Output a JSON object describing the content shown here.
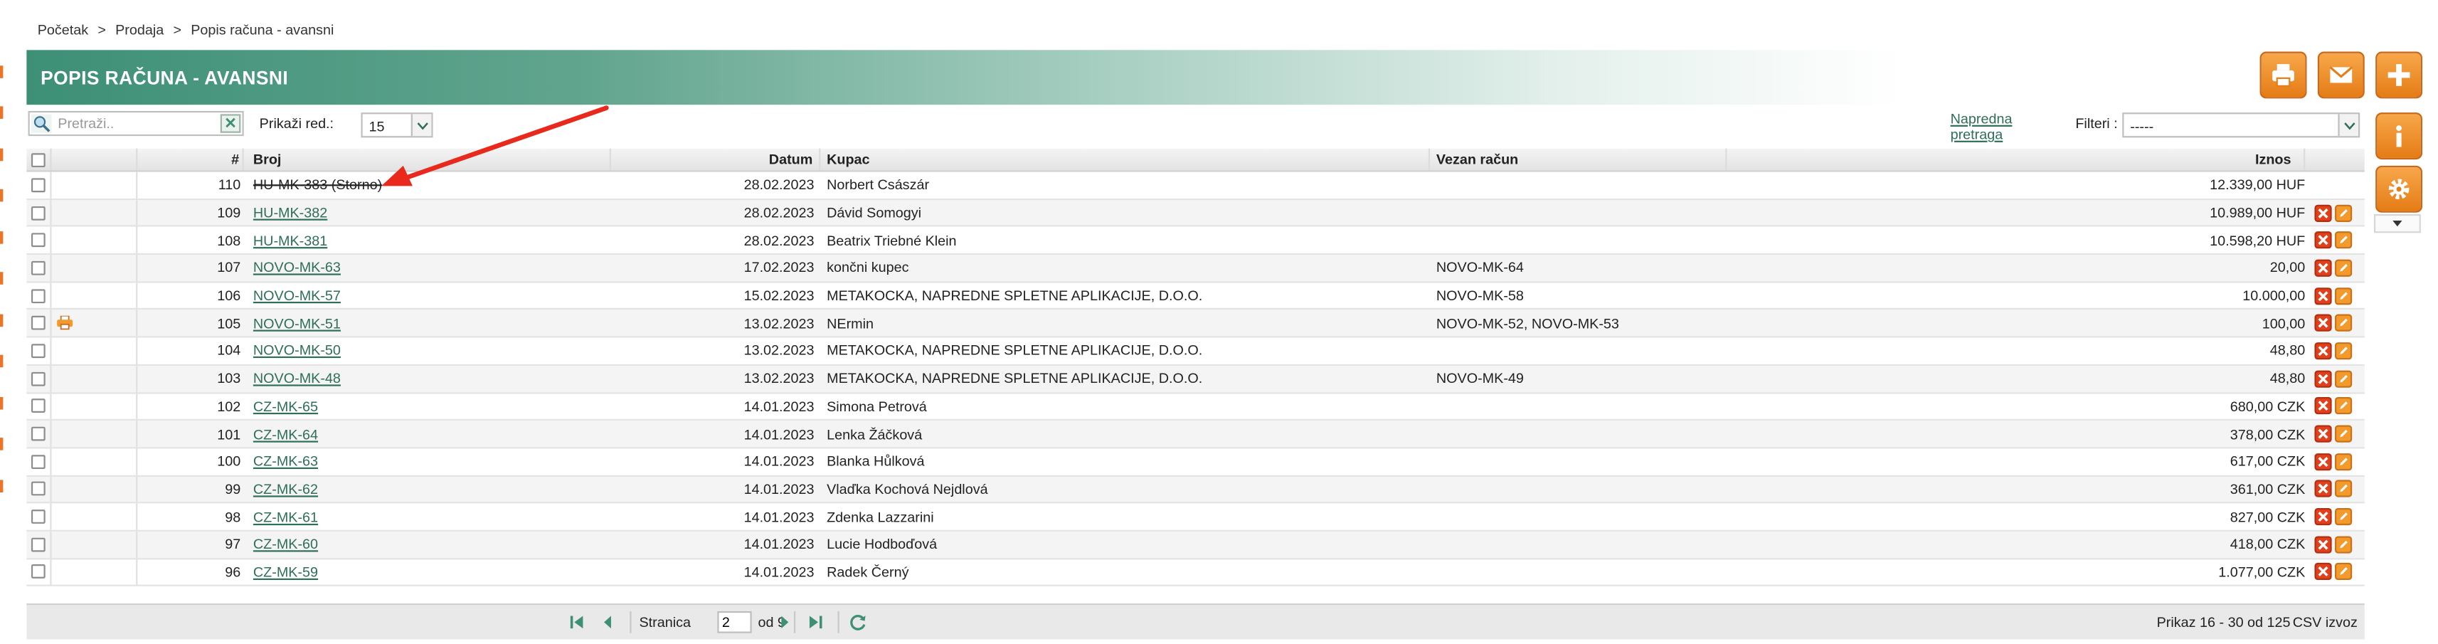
{
  "breadcrumb": {
    "items": [
      "Početak",
      "Prodaja",
      "Popis računa - avansni"
    ],
    "separator": ">"
  },
  "page": {
    "title": "POPIS RAČUNA - AVANSNI"
  },
  "toolbar": {
    "print_icon": "printer-icon",
    "email_icon": "envelope-icon",
    "add_icon": "plus-icon",
    "info_icon": "info-icon",
    "settings_icon": "gear-icon"
  },
  "search": {
    "placeholder": "Pretraži..",
    "value": ""
  },
  "rows_per_page": {
    "label": "Prikaži red.:",
    "value": "15"
  },
  "advanced_search": {
    "label_line1": "Napredna",
    "label_line2": "pretraga"
  },
  "filters": {
    "label": "Filteri :",
    "value": "-----"
  },
  "table": {
    "columns": {
      "num": "#",
      "broj": "Broj",
      "datum": "Datum",
      "kupac": "Kupac",
      "vezan": "Vezan račun",
      "iznos": "Iznos"
    },
    "rows": [
      {
        "num": "110",
        "broj": "HU-MK-383 (Storno)",
        "storno": true,
        "datum": "28.02.2023",
        "kupac": "Norbert Császár",
        "vezan": "",
        "iznos": "12.339,00 HUF",
        "printed": false,
        "actions": false
      },
      {
        "num": "109",
        "broj": "HU-MK-382",
        "storno": false,
        "datum": "28.02.2023",
        "kupac": "Dávid Somogyi",
        "vezan": "",
        "iznos": "10.989,00 HUF",
        "printed": false,
        "actions": true
      },
      {
        "num": "108",
        "broj": "HU-MK-381",
        "storno": false,
        "datum": "28.02.2023",
        "kupac": "Beatrix Triebné Klein",
        "vezan": "",
        "iznos": "10.598,20 HUF",
        "printed": false,
        "actions": true
      },
      {
        "num": "107",
        "broj": "NOVO-MK-63",
        "storno": false,
        "datum": "17.02.2023",
        "kupac": "končni kupec",
        "vezan": "NOVO-MK-64",
        "iznos": "20,00",
        "printed": false,
        "actions": true
      },
      {
        "num": "106",
        "broj": "NOVO-MK-57",
        "storno": false,
        "datum": "15.02.2023",
        "kupac": "METAKOCKA, NAPREDNE SPLETNE APLIKACIJE, D.O.O.",
        "vezan": "NOVO-MK-58",
        "iznos": "10.000,00",
        "printed": false,
        "actions": true
      },
      {
        "num": "105",
        "broj": "NOVO-MK-51",
        "storno": false,
        "datum": "13.02.2023",
        "kupac": "NErmin",
        "vezan": "NOVO-MK-52, NOVO-MK-53",
        "iznos": "100,00",
        "printed": true,
        "actions": true
      },
      {
        "num": "104",
        "broj": "NOVO-MK-50",
        "storno": false,
        "datum": "13.02.2023",
        "kupac": "METAKOCKA, NAPREDNE SPLETNE APLIKACIJE, D.O.O.",
        "vezan": "",
        "iznos": "48,80",
        "printed": false,
        "actions": true
      },
      {
        "num": "103",
        "broj": "NOVO-MK-48",
        "storno": false,
        "datum": "13.02.2023",
        "kupac": "METAKOCKA, NAPREDNE SPLETNE APLIKACIJE, D.O.O.",
        "vezan": "NOVO-MK-49",
        "iznos": "48,80",
        "printed": false,
        "actions": true
      },
      {
        "num": "102",
        "broj": "CZ-MK-65",
        "storno": false,
        "datum": "14.01.2023",
        "kupac": "Simona Petrová",
        "vezan": "",
        "iznos": "680,00 CZK",
        "printed": false,
        "actions": true
      },
      {
        "num": "101",
        "broj": "CZ-MK-64",
        "storno": false,
        "datum": "14.01.2023",
        "kupac": "Lenka Žáčková",
        "vezan": "",
        "iznos": "378,00 CZK",
        "printed": false,
        "actions": true
      },
      {
        "num": "100",
        "broj": "CZ-MK-63",
        "storno": false,
        "datum": "14.01.2023",
        "kupac": "Blanka Hůlková",
        "vezan": "",
        "iznos": "617,00 CZK",
        "printed": false,
        "actions": true
      },
      {
        "num": "99",
        "broj": "CZ-MK-62",
        "storno": false,
        "datum": "14.01.2023",
        "kupac": "Vlaďka Kochová Nejdlová",
        "vezan": "",
        "iznos": "361,00 CZK",
        "printed": false,
        "actions": true
      },
      {
        "num": "98",
        "broj": "CZ-MK-61",
        "storno": false,
        "datum": "14.01.2023",
        "kupac": "Zdenka Lazzarini",
        "vezan": "",
        "iznos": "827,00 CZK",
        "printed": false,
        "actions": true
      },
      {
        "num": "97",
        "broj": "CZ-MK-60",
        "storno": false,
        "datum": "14.01.2023",
        "kupac": "Lucie Hodboďová",
        "vezan": "",
        "iznos": "418,00 CZK",
        "printed": false,
        "actions": true
      },
      {
        "num": "96",
        "broj": "CZ-MK-59",
        "storno": false,
        "datum": "14.01.2023",
        "kupac": "Radek Černý",
        "vezan": "",
        "iznos": "1.077,00 CZK",
        "printed": false,
        "actions": true
      }
    ]
  },
  "pager": {
    "page_label": "Stranica",
    "page_value": "2",
    "of_label": "od 9",
    "info": "Prikaz 16 - 30 od 125",
    "csv": "CSV izvoz"
  },
  "colors": {
    "accent": "#3d8f76",
    "button_orange": "#f29a2c",
    "delete_red": "#e0401b",
    "annotation_arrow": "#e8291c"
  }
}
